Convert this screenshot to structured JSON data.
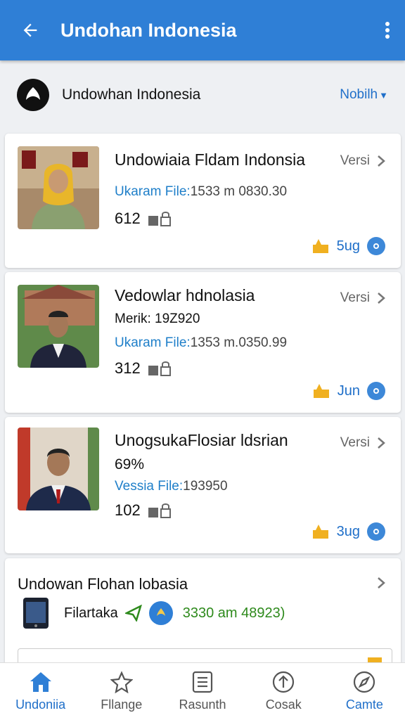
{
  "appbar": {
    "title": "Undohan Indonesia"
  },
  "subheader": {
    "name": "Undowhan Indonesia",
    "sort": "Nobilh"
  },
  "cards": [
    {
      "title": "Undowiaia Fldam Indonsia",
      "versi": "Versi",
      "meta": null,
      "file_label": "Ukaram File:",
      "file_value": "1533  m 0830.30",
      "count": "612",
      "badge": "5ug"
    },
    {
      "title": "Vedowlar hdnolasia",
      "versi": "Versi",
      "meta": "Merik: 19Z920",
      "file_label": "Ukaram File:",
      "file_value": "1353  m.0350.99",
      "count": "312",
      "badge": "Jun"
    },
    {
      "title": "UnogsukaFlosiar ldsrian",
      "versi": "Versi",
      "meta": "69%",
      "file_label": "Vessia File:",
      "file_value": "193950",
      "count": "102",
      "badge": "3ug"
    }
  ],
  "card4": {
    "title": "Undowan Flohan lobasia",
    "label": "Filartaka",
    "value": "3330 am 48923)"
  },
  "nav": [
    {
      "label": "Undoniia",
      "icon": "home-icon"
    },
    {
      "label": "Fllange",
      "icon": "star-icon"
    },
    {
      "label": "Rasunth",
      "icon": "list-icon"
    },
    {
      "label": "Cosak",
      "icon": "upload-icon"
    },
    {
      "label": "Camte",
      "icon": "compass-icon"
    }
  ],
  "colors": {
    "appbar": "#2f7fd6",
    "accent": "#1f6fc9",
    "green": "#2e8a1c"
  }
}
